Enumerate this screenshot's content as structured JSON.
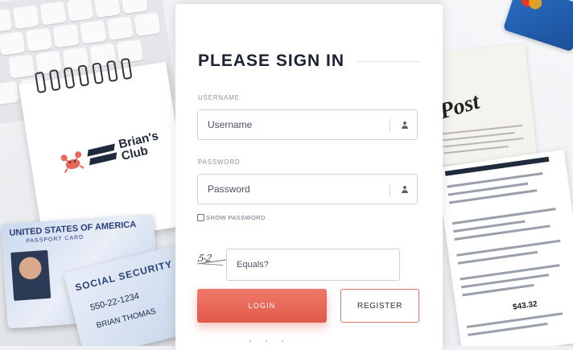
{
  "background": {
    "brand_name": "Brian's Club",
    "passport_title": "UNITED STATES OF AMERICA",
    "passport_sub": "PASSPORT CARD",
    "social_title": "SOCIAL SECURITY",
    "social_number": "550-22-1234",
    "social_name": "BRIAN THOMAS",
    "newspaper_word": "Post",
    "bill_total": "$43.32"
  },
  "login": {
    "title": "PLEASE SIGN IN",
    "username_label": "USERNAME",
    "username_placeholder": "Username",
    "username_value": "",
    "password_label": "PASSWORD",
    "password_placeholder": "Password",
    "password_value": "",
    "show_password_label": "SHOW PASSWORD",
    "show_password_checked": false,
    "captcha_text": "5-2",
    "equals_placeholder": "Equals?",
    "equals_value": "",
    "login_label": "LOGIN",
    "register_label": "REGISTER"
  },
  "colors": {
    "accent": "#e8695a",
    "title": "#1c2233",
    "field_border": "#c6d4e6"
  },
  "icons": {
    "username_icon": "person-icon",
    "password_icon": "person-icon"
  }
}
